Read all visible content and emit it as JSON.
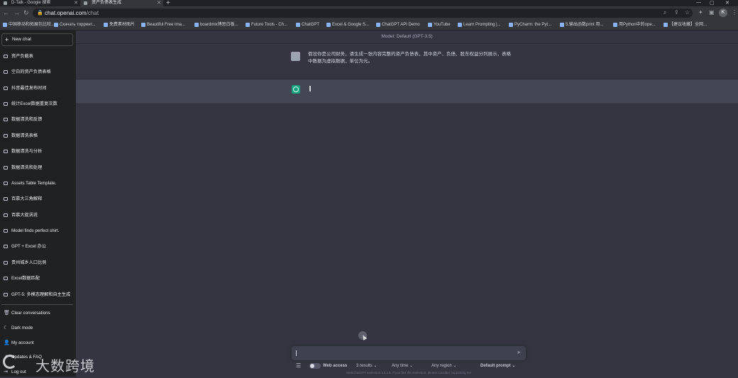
{
  "browser": {
    "tabs": [
      {
        "title": "D-Talk - Google 搜索",
        "active": false
      },
      {
        "title": "资产负债表生成",
        "active": true
      }
    ],
    "url_host": "chat.openai.com",
    "url_path": "/chat",
    "profile_initial": "K",
    "bookmarks": [
      "中国移动和拓展包比较...",
      "Скачать торрент...",
      "免费素材图片",
      "Beautiful Free Ima...",
      "boardmix博思白板...",
      "Future Tools - Ch...",
      "ChatGPT",
      "Excel & Google S...",
      "ChatGPT API Demo",
      "YouTube",
      "Learn Prompting |...",
      "PyCharm: the Pyt...",
      "5.输出函数print 用...",
      "用Python中的ope...",
      "【建议收藏】全网..."
    ]
  },
  "sidebar": {
    "new_chat": "New chat",
    "conversations": [
      "资产负载表",
      "空白的资产负债表格",
      "抖音最佳发布时间",
      "统计Excel数据重复次数",
      "数据清洗和反馈",
      "数据清洗表格",
      "数据清洗与分析",
      "数据清洗和处理",
      "Assets Table Template.",
      "百慕大三角解释",
      "百慕大旋涡说",
      "Model finds perfect shirt.",
      "GPT + Excel 办公",
      "贵州城乡人口比例",
      "Excel数据匹配",
      "GPT-5: 多模态理解和自主生成"
    ],
    "bottom": {
      "clear": "Clear conversations",
      "dark_mode": "Dark mode",
      "account": "My account",
      "updates": "Updates & FAQ",
      "logout": "Log out"
    }
  },
  "main": {
    "model_label": "Model: Default (GPT-3.5)",
    "user_message": "假设你是公司财务，请生成一张内容完整的资产负债表，其中资产、负债、股东权益分列展示，表格中数据为虚拟数据，单位为元。"
  },
  "input": {
    "placeholder": "",
    "web_access": "Web access",
    "results": "3 results",
    "time": "Any time",
    "region": "Any region",
    "prompt": "Default prompt",
    "footer": "WebChatGPT extension v.3.1.5. If you like the extension, please consider supporting me"
  },
  "watermark": {
    "text": "大数跨境"
  }
}
